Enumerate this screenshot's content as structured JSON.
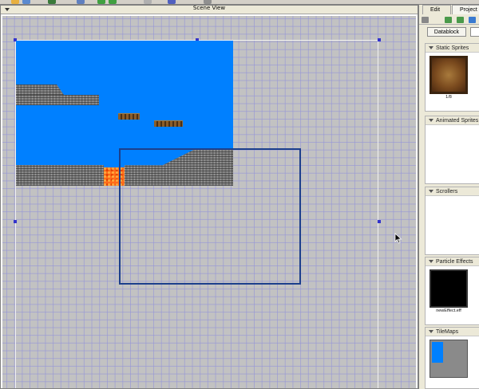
{
  "scene_view": {
    "title": "Scene View"
  },
  "right_panel": {
    "tabs": [
      {
        "label": "Edit"
      },
      {
        "label": "Project"
      }
    ],
    "datablock_tab": "Datablock",
    "sections": [
      {
        "title": "Static Sprites",
        "items": [
          {
            "label": "1/8",
            "thumbnail": "rusty-tile-texture"
          }
        ]
      },
      {
        "title": "Animated Sprites",
        "items": []
      },
      {
        "title": "Scrollers",
        "items": []
      },
      {
        "title": "Particle Effects",
        "items": [
          {
            "label": "newEffect.eff",
            "thumbnail": "black-particle-preview"
          }
        ]
      },
      {
        "title": "TileMaps",
        "items": [
          {
            "label": "",
            "thumbnail": "tilemap-preview"
          }
        ]
      }
    ]
  },
  "colors": {
    "sky": "#0080ff",
    "canvas_bg": "#c2c2c2",
    "grid": "#9696d7",
    "camera_outline": "#1c3f8c",
    "lava": "#ff6a1a",
    "selection_handles": "#3333cc"
  },
  "icons": [
    "cursor-arrow-icon",
    "collapse-arrow-icon",
    "section-collapse-icon"
  ]
}
